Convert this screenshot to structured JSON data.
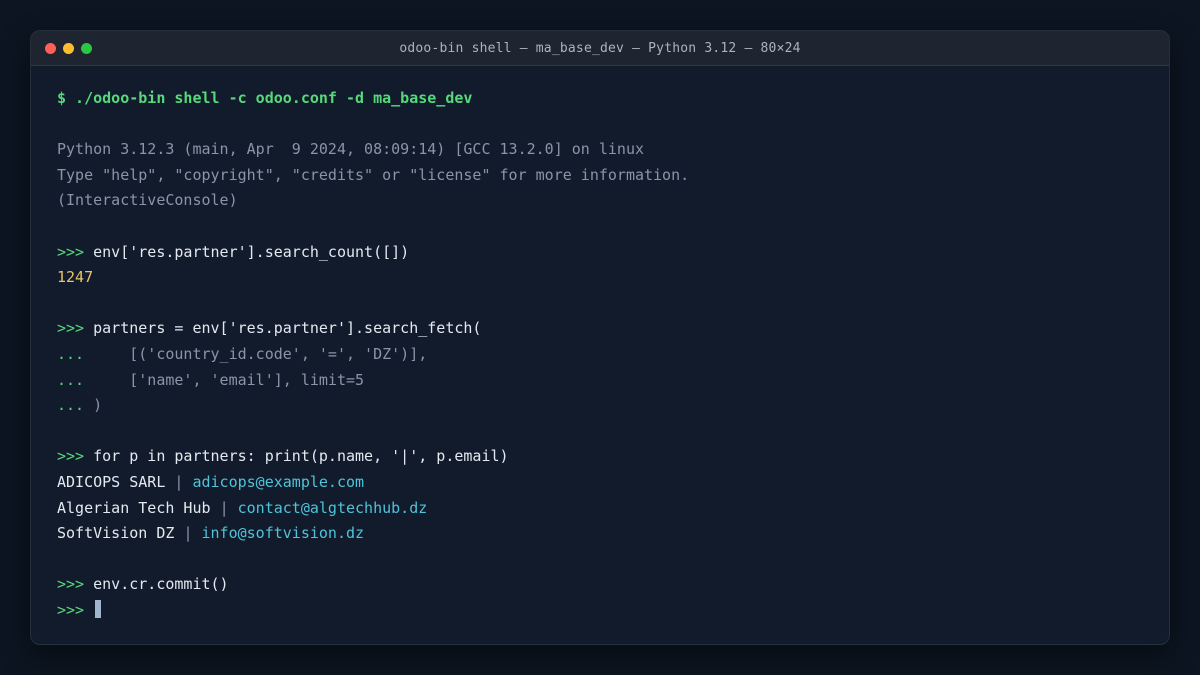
{
  "window": {
    "title": "odoo-bin shell — ma_base_dev — Python 3.12 — 80×24"
  },
  "terminal": {
    "start_command": "$ ./odoo-bin shell -c odoo.conf -d ma_base_dev",
    "banner": [
      "Python 3.12.3 (main, Apr  9 2024, 08:09:14) [GCC 13.2.0] on linux",
      "Type \"help\", \"copyright\", \"credits\" or \"license\" for more information.",
      "(InteractiveConsole)"
    ],
    "prompt": ">>>",
    "continuation": "...",
    "block1": {
      "input": "env['res.partner'].search_count([])",
      "output": "1247"
    },
    "block2": {
      "input": "partners = env['res.partner'].search_fetch(",
      "cont_lines": [
        "    [('country_id.code', '=', 'DZ')],",
        "    ['name', 'email'], limit=5",
        ")"
      ]
    },
    "block3": {
      "input": "for p in partners: print(p.name, '|', p.email)",
      "rows": [
        {
          "name": "ADICOPS SARL",
          "sep": "|",
          "email": "adicops@example.com"
        },
        {
          "name": "Algerian Tech Hub",
          "sep": "|",
          "email": "contact@algtechhub.dz"
        },
        {
          "name": "SoftVision DZ",
          "sep": "|",
          "email": "info@softvision.dz"
        }
      ]
    },
    "block4": {
      "input": "env.cr.commit()"
    }
  }
}
